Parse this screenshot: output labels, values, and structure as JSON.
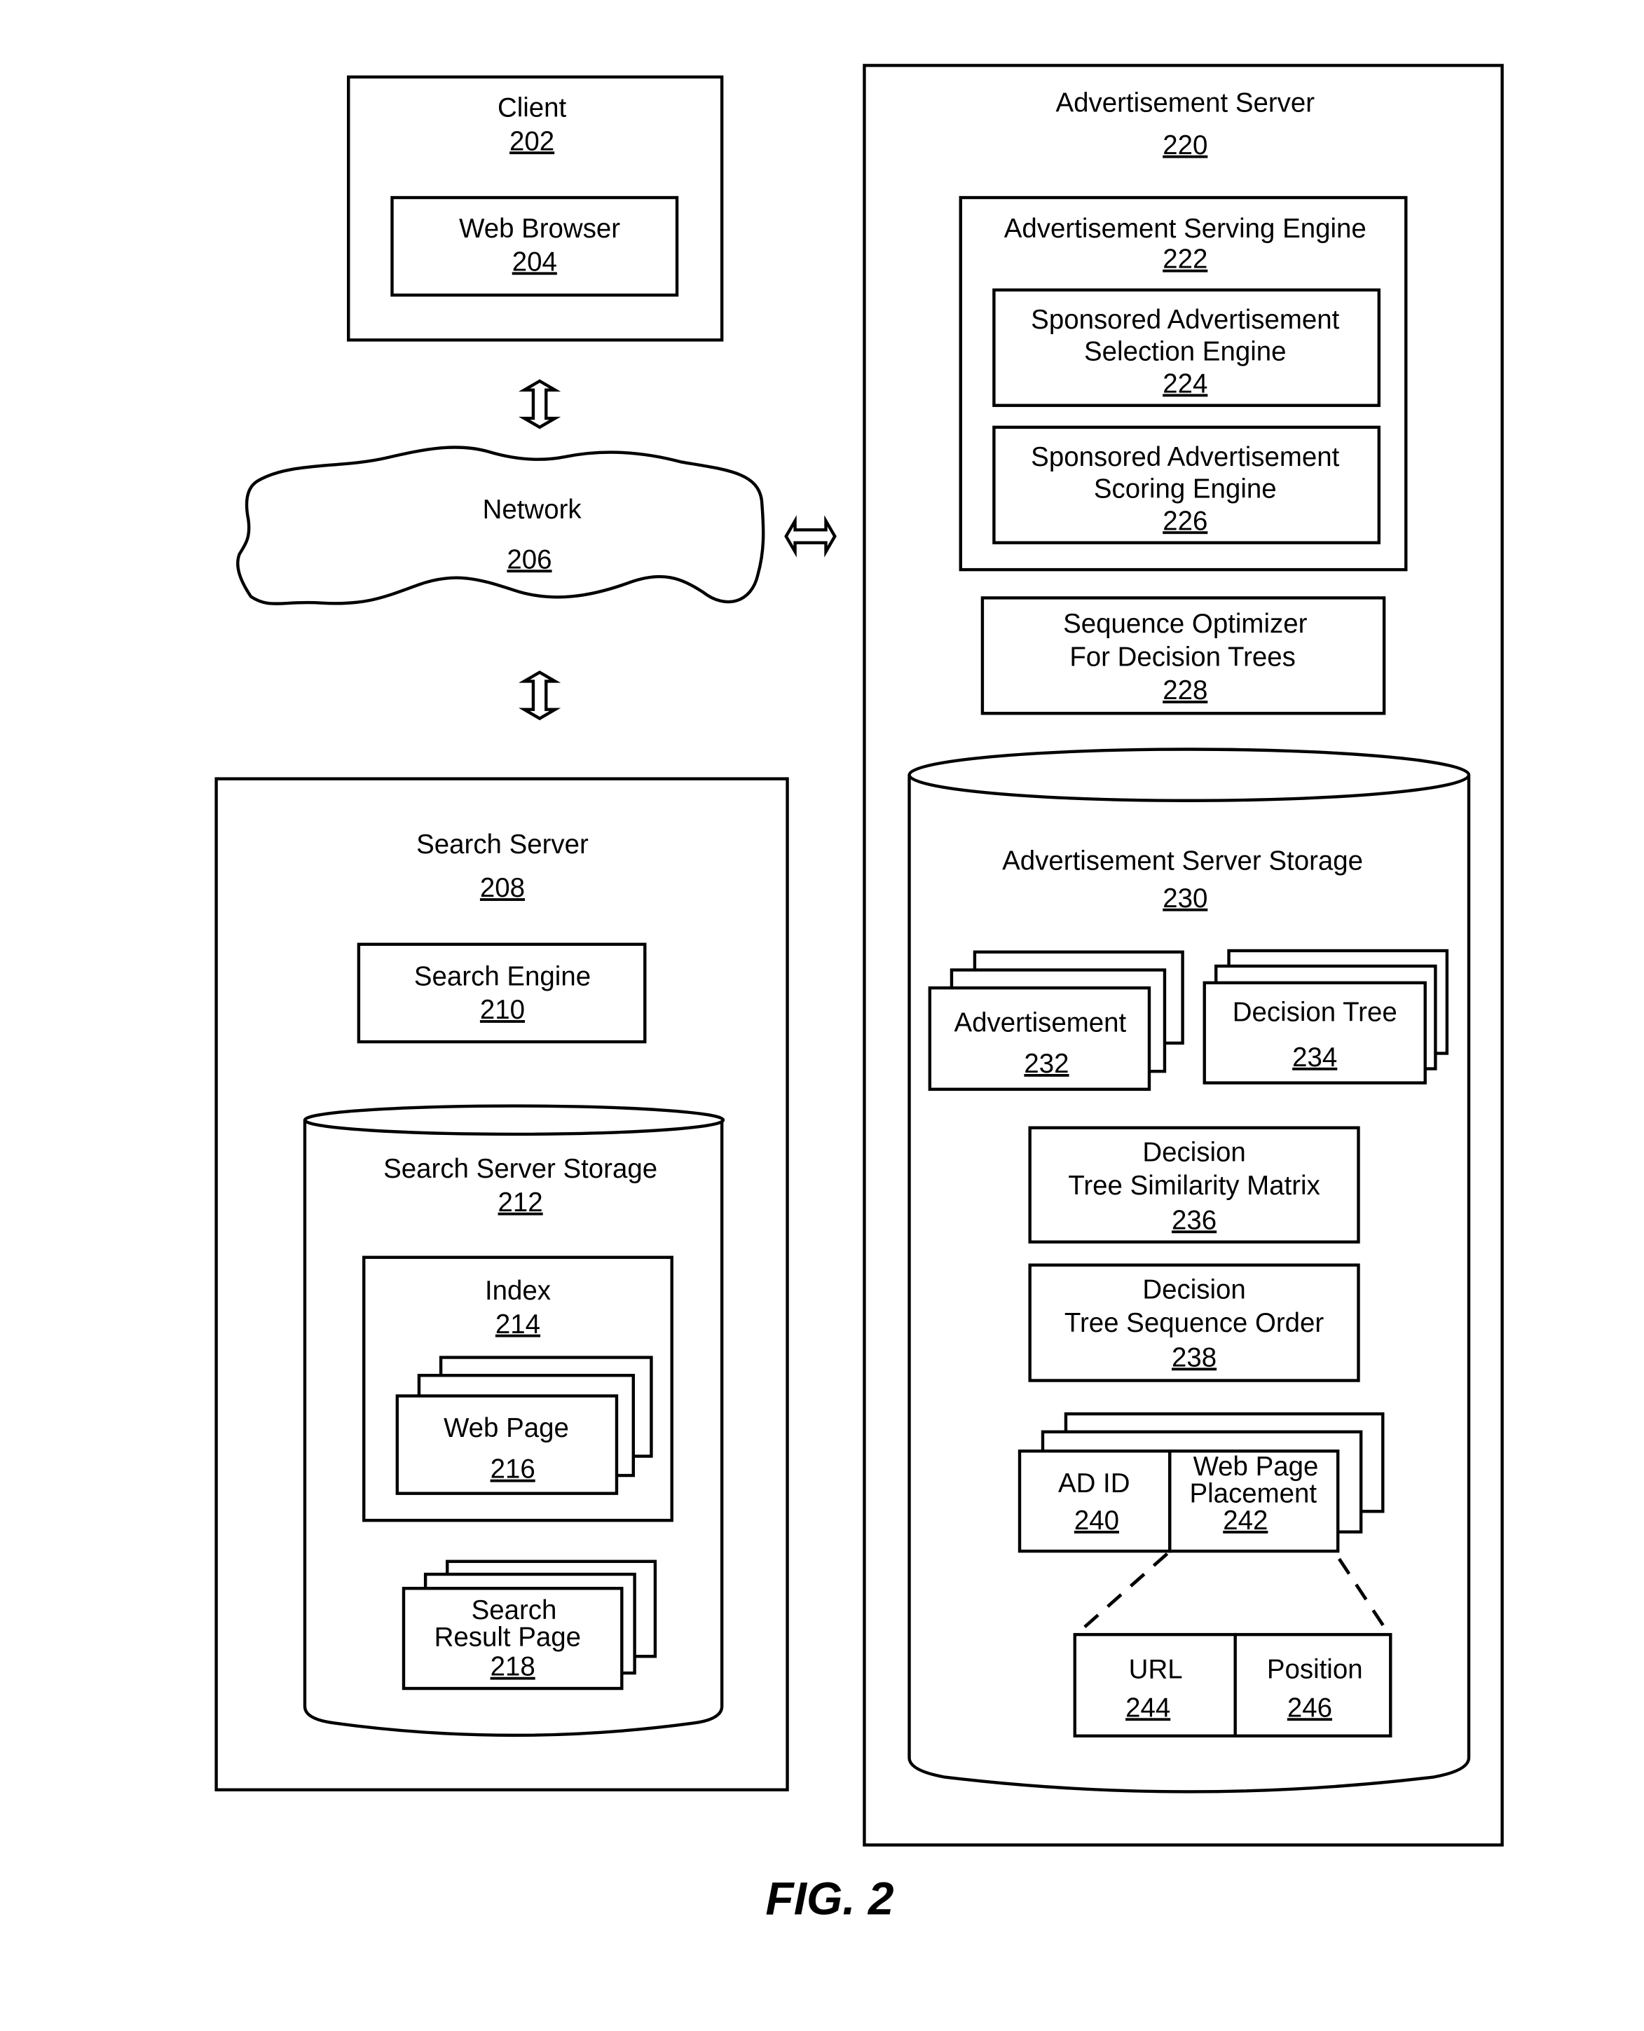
{
  "figure": {
    "caption": "FIG. 2"
  },
  "client": {
    "label": "Client",
    "number": "202",
    "web_browser": {
      "label": "Web Browser",
      "number": "204"
    }
  },
  "network": {
    "label": "Network",
    "number": "206"
  },
  "search_server": {
    "label": "Search Server",
    "number": "208",
    "search_engine": {
      "label": "Search Engine",
      "number": "210"
    },
    "storage": {
      "label": "Search Server Storage",
      "number": "212",
      "index": {
        "label": "Index",
        "number": "214",
        "web_page": {
          "label": "Web Page",
          "number": "216"
        }
      },
      "search_result_page": {
        "label_line1": "Search",
        "label_line2": "Result Page",
        "number": "218"
      }
    }
  },
  "ad_server": {
    "label": "Advertisement Server",
    "number": "220",
    "serving_engine": {
      "label": "Advertisement Serving Engine",
      "number": "222",
      "selection_engine": {
        "label_line1": "Sponsored Advertisement",
        "label_line2": "Selection Engine",
        "number": "224"
      },
      "scoring_engine": {
        "label_line1": "Sponsored Advertisement",
        "label_line2": "Scoring Engine",
        "number": "226"
      }
    },
    "sequence_optimizer": {
      "label_line1": "Sequence Optimizer",
      "label_line2": "For Decision Trees",
      "number": "228"
    },
    "storage": {
      "label": "Advertisement Server Storage",
      "number": "230",
      "advertisement": {
        "label": "Advertisement",
        "number": "232"
      },
      "decision_tree": {
        "label": "Decision Tree",
        "number": "234"
      },
      "similarity_matrix": {
        "label_line1": "Decision",
        "label_line2": "Tree Similarity Matrix",
        "number": "236"
      },
      "sequence_order": {
        "label_line1": "Decision",
        "label_line2": "Tree Sequence Order",
        "number": "238"
      },
      "ad_id": {
        "label": "AD ID",
        "number": "240"
      },
      "web_page_placement": {
        "label_line1": "Web Page",
        "label_line2": "Placement",
        "number": "242"
      },
      "url": {
        "label": "URL",
        "number": "244"
      },
      "position": {
        "label": "Position",
        "number": "246"
      }
    }
  }
}
